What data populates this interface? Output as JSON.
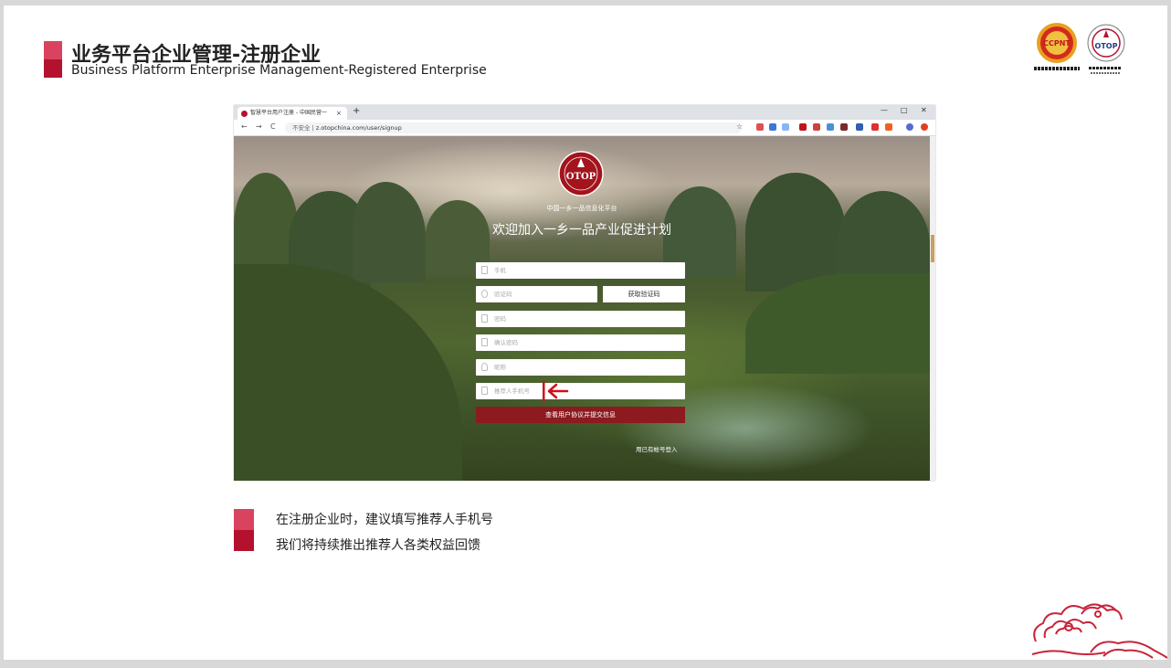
{
  "slide": {
    "title_cn": "业务平台企业管理-注册企业",
    "title_en": "Business Platform Enterprise Management-Registered Enterprise",
    "notes": [
      "在注册企业时，建议填写推荐人手机号",
      "我们将持续推出推荐人各类权益回馈"
    ]
  },
  "logos": {
    "left_label": "CCPNT",
    "right_label": "OTOP"
  },
  "browser": {
    "tab_title": "智慧平台用户注册 - 中国民营一",
    "tab_close": "×",
    "new_tab": "+",
    "controls": [
      "—",
      "□",
      "✕"
    ],
    "nav": [
      "←",
      "→",
      "C"
    ],
    "insecure_label": "不安全 |",
    "url": "z.otopchina.com/user/signup",
    "star": "☆"
  },
  "site": {
    "logo_text": "OTOP",
    "platform_name": "中国一乡一品信息化平台",
    "headline": "欢迎加入一乡一品产业促进计划",
    "fields": {
      "phone": "手机",
      "code": "验证码",
      "password": "密码",
      "confirm_password": "确认密码",
      "nickname": "昵称",
      "referrer_phone": "推荐人手机号"
    },
    "get_code_button": "获取验证码",
    "submit_button": "查看用户协议并提交信息",
    "login_link": "用已有帐号登入"
  },
  "colors": {
    "accent_light": "#d9435f",
    "accent_dark": "#b4112f",
    "submit": "#8c1a1f",
    "arrow": "#d0101c"
  }
}
